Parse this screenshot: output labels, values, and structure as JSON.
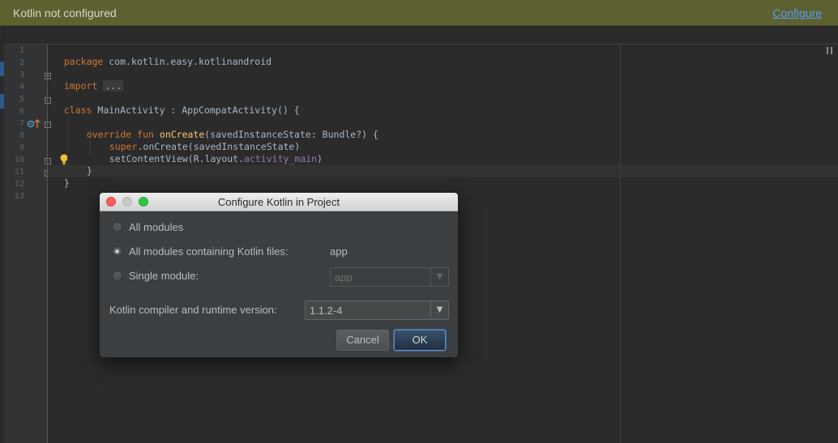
{
  "banner": {
    "title": "Kotlin not configured",
    "configure_link": "Configure",
    "background_color": "#5d6130",
    "link_color": "#589df6"
  },
  "editor": {
    "line_numbers": [
      "1",
      "2",
      "3",
      "4",
      "5",
      "6",
      "7",
      "8",
      "9",
      "10",
      "11",
      "12",
      "13"
    ],
    "lines": {
      "l1": {
        "kw": "package",
        "text": " com.kotlin.easy.kotlinandroid"
      },
      "l3": {
        "kw": "import",
        "folded": "..."
      },
      "l6": {
        "kw": "class",
        "text": " MainActivity : AppCompatActivity() {"
      },
      "l8": {
        "kw": "override fun",
        "fn": "onCreate",
        "text": "(savedInstanceState: Bundle?) {"
      },
      "l9": {
        "kw": "super",
        "text": ".onCreate(savedInstanceState)"
      },
      "l10": {
        "text": "setContentView(R.layout.",
        "prop": "activity_main",
        "tail": ")"
      },
      "l11": {
        "text": "}"
      },
      "l12": {
        "text": "}"
      }
    },
    "keyword_color": "#cc7832",
    "function_color": "#ffc66d",
    "property_color": "#9876aa",
    "text_color": "#a9b7c6"
  },
  "dialog": {
    "title": "Configure Kotlin in Project",
    "options": [
      {
        "label": "All modules",
        "checked": false
      },
      {
        "label": "All modules containing Kotlin files:",
        "checked": true,
        "value": "app"
      },
      {
        "label": "Single module:",
        "checked": false,
        "combo_value": "app"
      }
    ],
    "version_label": "Kotlin compiler and runtime version:",
    "version_value": "1.1.2-4",
    "cancel_label": "Cancel",
    "ok_label": "OK"
  }
}
